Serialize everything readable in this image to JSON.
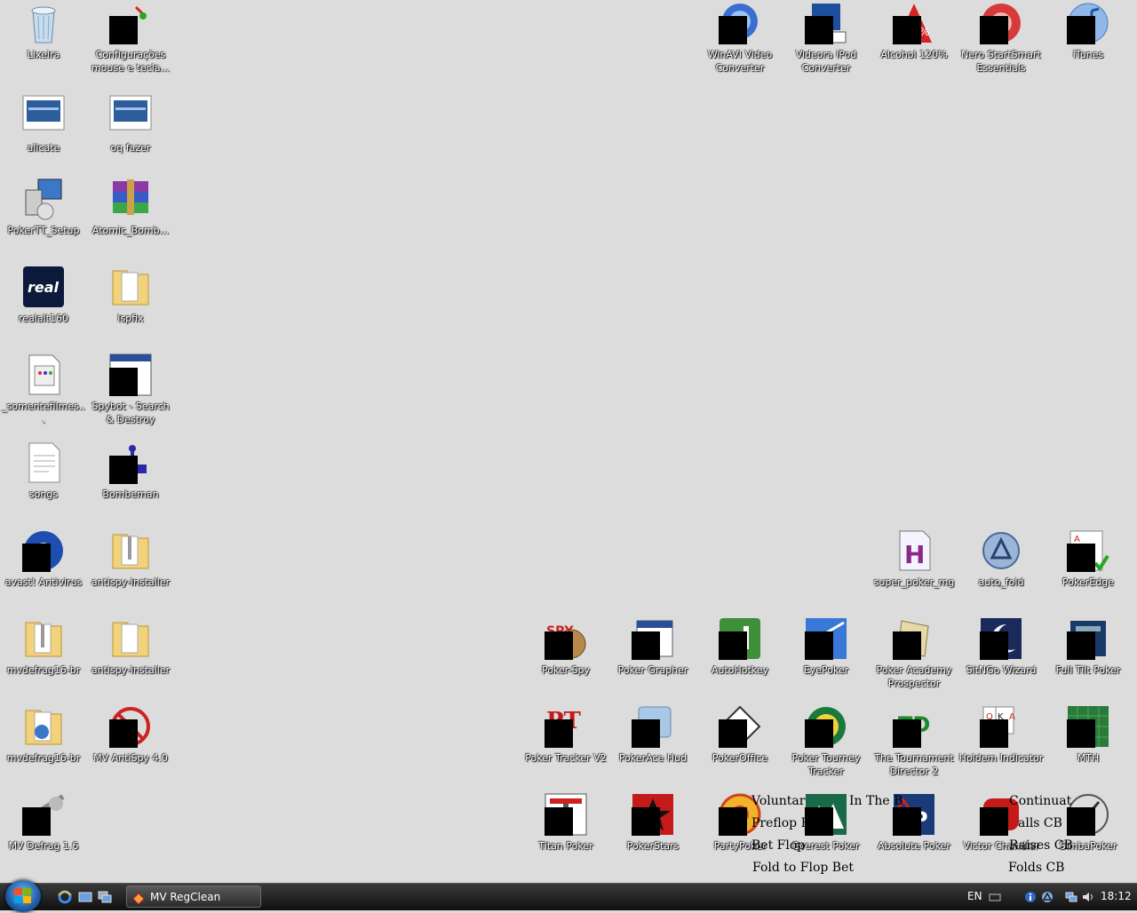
{
  "desktop": {
    "icons": {
      "lixeira": "Lixeira",
      "configuracoes": "Configurações mouse e tecla...",
      "winavi": "WinAVI Video Converter",
      "videora": "Videora iPod Converter",
      "alcohol": "Alcohol 120%",
      "nero": "Nero StartSmart Essentials",
      "itunes": "iTunes",
      "alicate": "alicate",
      "oqfazer": "oq fazer",
      "pokertt": "PokerTT_Setup",
      "atomic": "Atomic_Bomb...",
      "realalt": "realalt160",
      "lspfix": "lspfix",
      "somentefilmes": "_somentefilmes...",
      "spybot": "Spybot - Search & Destroy",
      "songs": "songs",
      "bombeman": "Bombeman",
      "avast": "avast! Antivirus",
      "antispy1": "antispy-installer",
      "superpoker": "super_poker_mg",
      "autofold": "auto_fold",
      "pokeredge": "PokerEdge",
      "mvdefrag1": "mvdefrag16-br",
      "antispy2": "antispy-installer",
      "pokerspy": "Poker-Spy",
      "pokergrapher": "Poker Grapher",
      "autohotkey": "AutoHotkey",
      "eyepoker": "EyePoker",
      "pokeracademy": "Poker Academy Prospector",
      "sitngo": "SitNGo Wizard",
      "fulltilt": "Full Tilt Poker",
      "mvdefrag2": "mvdefrag16-br",
      "mvantispy": "MV AntiSpy 4.0",
      "pokertracker": "Poker Tracker V2",
      "pokerace": "PokerAce Hud",
      "pokeroffice": "PokerOffice",
      "pokertourney": "Poker Tourney Tracker",
      "tournamentdirector": "The Tournament Director 2",
      "holdem": "Holdem Indicator",
      "mth": "MTH",
      "mvdefrag16": "MV Defrag 1.6",
      "titan": "Titan Poker",
      "pokerstars": "PokerStars",
      "partypoker": "PartyPoker",
      "everest": "Everest Poker",
      "absolute": "Absolute Poker",
      "victor": "Victor Chandler",
      "simba": "SimbaPoker"
    },
    "overlay": {
      "voluntary": "Voluntar",
      "inthe": "In The B",
      "preflop": "Preflop R",
      "betflop": "Bet Flop",
      "foldtoflop": "Fold to Flop Bet",
      "continuation": "Continuat",
      "callscb": "alls CB",
      "raisescb": "Raises CB",
      "foldscb": "Folds CB"
    }
  },
  "taskbar": {
    "task_label": "MV RegClean",
    "language": "EN",
    "clock": "18:12"
  },
  "colors": {
    "desktop": "#dcdcdc",
    "taskbar": "#1a1a1a"
  }
}
